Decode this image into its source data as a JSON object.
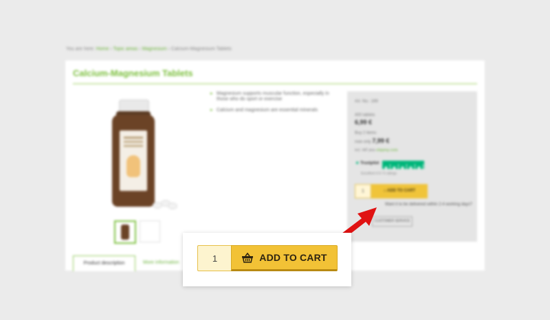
{
  "breadcrumb": {
    "prefix": "You are here:",
    "items": [
      "Home",
      "Topic areas",
      "Magnesium",
      "Calcium-Magnesium Tablets"
    ]
  },
  "product": {
    "title": "Calcium-Magnesium Tablets",
    "bullets": [
      "Magnesium supports muscular function, especially in those who do sport or exercise",
      "Calcium and magnesium are essential minerals"
    ]
  },
  "buybox": {
    "art_no": "Art. No.: 169",
    "unit_label": "400 tablets",
    "price": "6,99 €",
    "multi_label": "Buy 2 items",
    "multi_prefix": "now only",
    "multi_price": "7,99 €",
    "vat_prefix": "incl. VAT plus",
    "vat_link": "shipping costs",
    "trustpilot": {
      "brand": "Trustpilot",
      "rating_stars": 5,
      "sub": "Excellent 4.9 / 5 ratings"
    },
    "mini_qty": "1",
    "mini_cart_label": "ADD TO CART",
    "delivery_text": "Want it to be delivered within 2-4 working days?",
    "service_label": "CUSTOMER SERVICE"
  },
  "tabs": [
    "Product description",
    "More information"
  ],
  "zoom": {
    "quantity": "1",
    "add_to_cart_label": "ADD TO CART"
  },
  "colors": {
    "brand_green": "#7bbf3c",
    "cart_yellow": "#f2c236",
    "arrow_red": "#e01212",
    "trustpilot_green": "#00b67a"
  },
  "icons": {
    "cart": "basket-icon",
    "pointer": "red-arrow-icon",
    "trustpilot": "star-icon"
  }
}
